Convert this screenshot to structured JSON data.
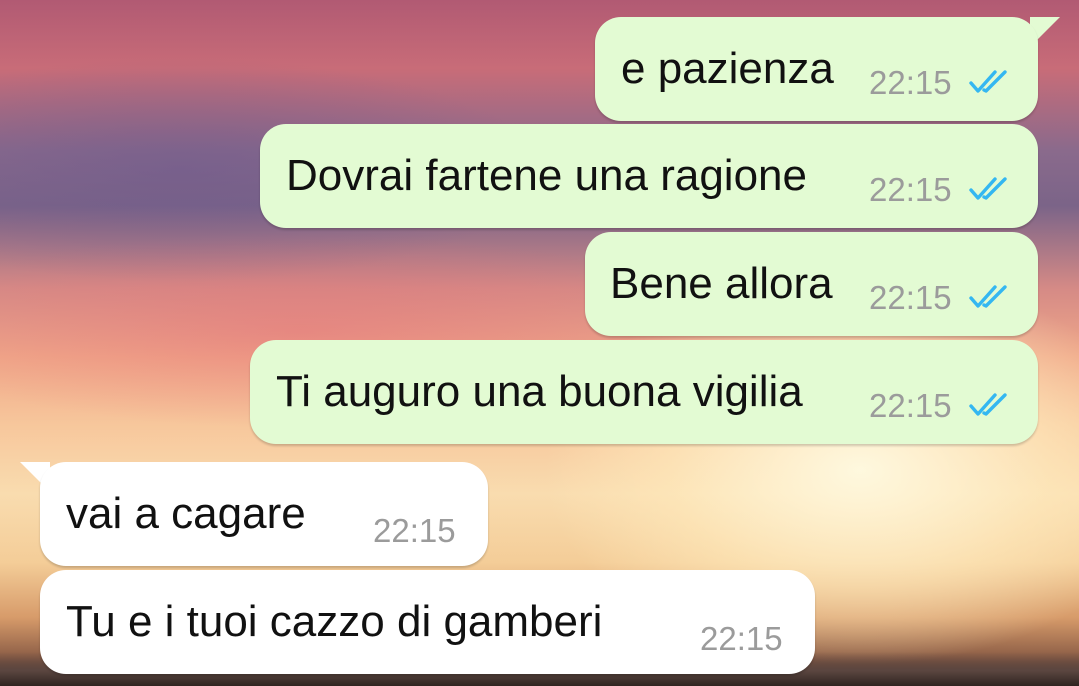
{
  "chat": {
    "messages": [
      {
        "direction": "outgoing",
        "text": "e pazienza",
        "time": "22:15",
        "status": "read",
        "status_icon": "double-check-icon"
      },
      {
        "direction": "outgoing",
        "text": "Dovrai fartene una ragione",
        "time": "22:15",
        "status": "read",
        "status_icon": "double-check-icon"
      },
      {
        "direction": "outgoing",
        "text": "Bene allora",
        "time": "22:15",
        "status": "read",
        "status_icon": "double-check-icon"
      },
      {
        "direction": "outgoing",
        "text": "Ti auguro una buona vigilia",
        "time": "22:15",
        "status": "read",
        "status_icon": "double-check-icon"
      },
      {
        "direction": "incoming",
        "text": "vai a cagare",
        "time": "22:15"
      },
      {
        "direction": "incoming",
        "text": "Tu e i tuoi cazzo di gamberi",
        "time": "22:15"
      }
    ]
  },
  "colors": {
    "outgoing_bubble": "#e3fbd3",
    "incoming_bubble": "#ffffff",
    "read_ticks": "#34b7f1",
    "timestamp": "#9b9b9b"
  }
}
